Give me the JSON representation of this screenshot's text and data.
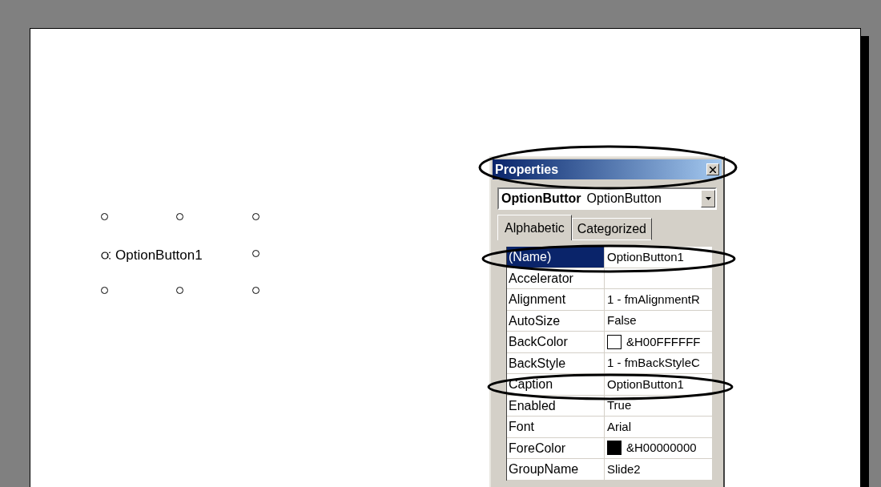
{
  "slide": {
    "option_button": {
      "caption": "OptionButton1",
      "selected": true
    }
  },
  "properties_window": {
    "title": "Properties",
    "object_box": {
      "name": "OptionButtor",
      "type": "OptionButton"
    },
    "tabs": [
      {
        "label": "Alphabetic",
        "selected": true
      },
      {
        "label": "Categorized",
        "selected": false
      }
    ],
    "rows": [
      {
        "name": "(Name)",
        "value": "OptionButton1",
        "selected": true,
        "kind": "text"
      },
      {
        "name": "Accelerator",
        "value": "",
        "selected": false,
        "kind": "text"
      },
      {
        "name": "Alignment",
        "value": "1 - fmAlignmentR",
        "selected": false,
        "kind": "text"
      },
      {
        "name": "AutoSize",
        "value": "False",
        "selected": false,
        "kind": "text"
      },
      {
        "name": "BackColor",
        "value": "&H00FFFFFF",
        "selected": false,
        "kind": "color",
        "color": "#ffffff"
      },
      {
        "name": "BackStyle",
        "value": "1 - fmBackStyleC",
        "selected": false,
        "kind": "text"
      },
      {
        "name": "Caption",
        "value": "OptionButton1",
        "selected": false,
        "kind": "text"
      },
      {
        "name": "Enabled",
        "value": "True",
        "selected": false,
        "kind": "text"
      },
      {
        "name": "Font",
        "value": "Arial",
        "selected": false,
        "kind": "text"
      },
      {
        "name": "ForeColor",
        "value": "&H00000000",
        "selected": false,
        "kind": "color",
        "color": "#000000"
      },
      {
        "name": "GroupName",
        "value": "Slide2",
        "selected": false,
        "kind": "text"
      }
    ]
  }
}
